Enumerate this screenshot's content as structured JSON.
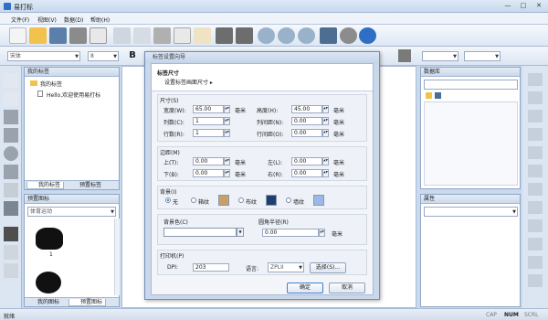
{
  "app": {
    "title": "易打标"
  },
  "menu": [
    "文件(F)",
    "视图(V)",
    "数据(D)",
    "帮助(H)"
  ],
  "window_controls": {
    "minimize": "—",
    "maximize": "□",
    "close": "✕"
  },
  "fontbar": {
    "font_name": "宋体",
    "font_size": "8",
    "bold": "B"
  },
  "left_panel": {
    "title": "我的标签",
    "tree_root": "我的标签",
    "tree_child": "Hello,欢迎使用易打标",
    "tabs": [
      "我的标签",
      "预置标签"
    ]
  },
  "icons_panel": {
    "title": "预置图标",
    "category": "体育运动",
    "first_label": "1",
    "tabs": [
      "我的图标",
      "预置图标"
    ]
  },
  "data_panel": {
    "title": "数据库"
  },
  "props_panel": {
    "title": "属性"
  },
  "status": {
    "left": "就绪",
    "caps": "CAP",
    "num": "NUM",
    "scrl": "SCRL"
  },
  "dialog": {
    "title": "标签设置向导",
    "header_title": "标签尺寸",
    "header_sub": "设置标签画面尺寸 ▸",
    "size": {
      "section": "尺寸(S)",
      "width_label": "宽度(W):",
      "width": "65.00",
      "width_unit": "毫米",
      "height_label": "高度(H):",
      "height": "45.00",
      "height_unit": "毫米",
      "cols_label": "列数(C):",
      "cols": "1",
      "colgap_label": "列间距(N):",
      "colgap": "0.00",
      "colgap_unit": "毫米",
      "rows_label": "行数(R):",
      "rows": "1",
      "rowgap_label": "行间距(O):",
      "rowgap": "0.00",
      "rowgap_unit": "毫米"
    },
    "margin": {
      "section": "边距(M)",
      "top_label": "上(T):",
      "top": "0.00",
      "top_unit": "毫米",
      "left_label": "左(L):",
      "left": "0.00",
      "left_unit": "毫米",
      "bottom_label": "下(B):",
      "bottom": "0.00",
      "bottom_unit": "毫米",
      "right_label": "右(R):",
      "right": "0.00",
      "right_unit": "毫米"
    },
    "background": {
      "section": "背景(I)",
      "options": [
        "无",
        "箱纹",
        "布纹",
        "墙纹"
      ],
      "selected": "无"
    },
    "bgcolor_label": "背景色(C)",
    "radius_label": "圆角半径(R)",
    "radius": "0.00",
    "radius_unit": "毫米",
    "printer": {
      "section": "打印机(P)",
      "dpi_label": "DPI:",
      "dpi": "203",
      "lang_label": "语言:",
      "lang": "ZPLII",
      "choose": "选择(S)..."
    },
    "ok": "确定",
    "cancel": "取消"
  }
}
